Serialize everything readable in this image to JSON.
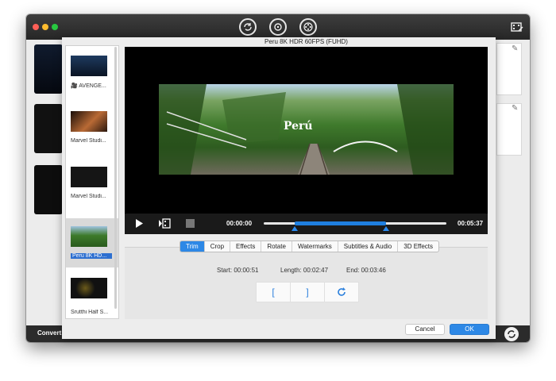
{
  "window": {
    "controls": [
      "close",
      "minimize",
      "zoom"
    ],
    "toolbar_icons": [
      "convert-icon",
      "burn-disc-icon",
      "film-reel-icon"
    ],
    "right_icon": "film-edit-icon"
  },
  "background": {
    "convert_label": "Convert a",
    "edit_icons": [
      "pencil-icon",
      "pencil-icon"
    ]
  },
  "clip_list": {
    "items": [
      {
        "label": "🎥 AVENGE..."
      },
      {
        "label": "Marvel Studi..."
      },
      {
        "label": "Marvel Studi..."
      },
      {
        "label": "Peru 8K HD...",
        "selected": true
      },
      {
        "label": "Srutthi Half S..."
      }
    ]
  },
  "player": {
    "title": "Peru 8K HDR 60FPS (FUHD)",
    "watermark": "Perú",
    "current_time": "00:00:00",
    "total_time": "00:05:37",
    "trim_start_fraction": 0.17,
    "trim_end_fraction": 0.67
  },
  "tabs": [
    "Trim",
    "Crop",
    "Effects",
    "Rotate",
    "Watermarks",
    "Subtitles & Audio",
    "3D Effects"
  ],
  "active_tab": "Trim",
  "trim": {
    "start": "Start: 00:00:51",
    "length": "Length: 00:02:47",
    "end": "End: 00:03:46",
    "set_start_glyph": "[",
    "set_end_glyph": "]"
  },
  "buttons": {
    "cancel": "Cancel",
    "ok": "OK"
  },
  "colors": {
    "accent": "#2d88e6",
    "dark": "#262626"
  }
}
